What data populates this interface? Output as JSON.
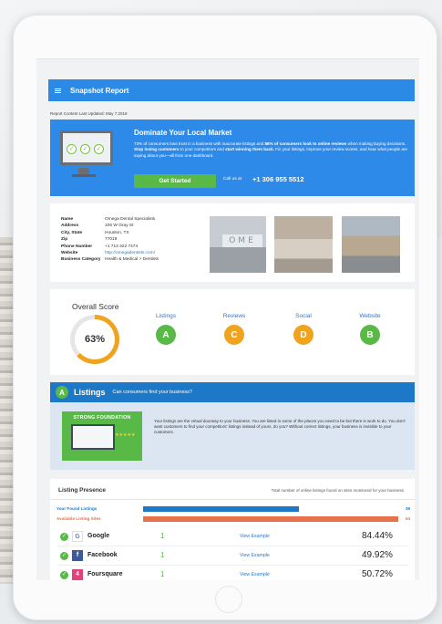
{
  "header": {
    "title": "Snapshot Report"
  },
  "report": {
    "updated": "Report Content Last Updated: May 7,2018"
  },
  "hero": {
    "title": "Dominate Your Local Market",
    "text_prefix": "73% of consumers lose trust in a business with inaccurate listings and ",
    "text_bold1": "88% of consumers look to online reviews",
    "text_mid1": " when making buying decisions. ",
    "text_bold2": "Stop losing customers",
    "text_mid2": " to your competitors and ",
    "text_bold3": "start winning them back.",
    "text_end": " Fix your listings, improve your review scores, and hear what people are saying about you—all from one dashboard.",
    "cta_label": "Get Started",
    "call_label": "Call us at",
    "phone": "+1 306 955 5512"
  },
  "business": {
    "rows": [
      {
        "label": "Name",
        "value": "Omega Dental Specialists"
      },
      {
        "label": "Address",
        "value": "106 W Gray St"
      },
      {
        "label": "City, State",
        "value": "Houston, TX"
      },
      {
        "label": "Zip",
        "value": "77019"
      },
      {
        "label": "Phone Number",
        "value": "+1 713 322 7474"
      },
      {
        "label": "Website",
        "value": "http://omegadentists.com/"
      },
      {
        "label": "Business Category",
        "value": "Health & Medical > Dentists"
      }
    ],
    "photo_sign": "OME"
  },
  "score": {
    "title": "Overall Score",
    "value": "63%",
    "percent": 63,
    "categories": [
      {
        "label": "Listings",
        "grade": "A",
        "color": "#58b947"
      },
      {
        "label": "Reviews",
        "grade": "C",
        "color": "#f0a31e"
      },
      {
        "label": "Social",
        "grade": "D",
        "color": "#f0a31e"
      },
      {
        "label": "Website",
        "grade": "B",
        "color": "#58b947"
      }
    ]
  },
  "listings": {
    "grade": "A",
    "heading": "Listings",
    "question": "Can consumers find your business?",
    "badge": "STRONG FOUNDATION",
    "stars": "★★★★★",
    "text": "Your listings are the virtual doorway to your business. You are listed in some of the places you need to be but there is work to do. You don't want customers to find your competitors' listings instead of yours, do you? Without correct listings, your business is invisible to your customers."
  },
  "presence": {
    "title": "Listing Presence",
    "subtitle": "Total number of online listings found on sites monitored for your business",
    "found_label": "Your Found Listings",
    "found_count": "39",
    "available_label": "Available Listing Sites",
    "available_count": "64",
    "colors": {
      "found": "#1e78c8",
      "available": "#e8704a"
    },
    "sites": [
      {
        "name": "Google",
        "count": "1",
        "link": "View Example",
        "pct": "84.44%",
        "logo": "G",
        "logo_color": "#ffffff"
      },
      {
        "name": "Facebook",
        "count": "1",
        "link": "View Example",
        "pct": "49.92%",
        "logo": "f",
        "logo_color": "#3b5998"
      },
      {
        "name": "Foursquare",
        "count": "1",
        "link": "View Example",
        "pct": "50.72%",
        "logo": "4",
        "logo_color": "#e3417a"
      }
    ]
  },
  "icons": {
    "menu": "menu-icon",
    "check": "check-icon",
    "monitor": "monitor-icon"
  }
}
